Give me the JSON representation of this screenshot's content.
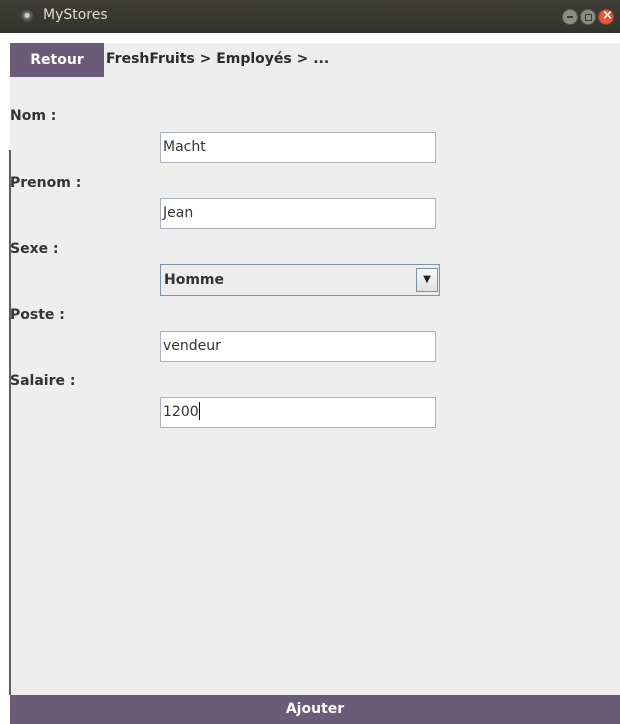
{
  "window": {
    "title": "MyStores",
    "icon": "app-icon",
    "controls": [
      "minimize-icon",
      "maximize-icon",
      "close-icon"
    ]
  },
  "toolbar": {
    "back_label": "Retour",
    "breadcrumb": "FreshFruits > Employés > ..."
  },
  "form": {
    "nom_label": "Nom :",
    "nom_value": "Macht",
    "prenom_label": "Prenom :",
    "prenom_value": "Jean",
    "sexe_label": "Sexe :",
    "sexe_value": "Homme",
    "poste_label": "Poste :",
    "poste_value": "vendeur",
    "salaire_label": "Salaire :",
    "salaire_value": "1200"
  },
  "actions": {
    "submit_label": "Ajouter"
  },
  "colors": {
    "titlebar": "#3e3d38",
    "accent": "#6b5b79",
    "panel": "#eeeeee"
  }
}
